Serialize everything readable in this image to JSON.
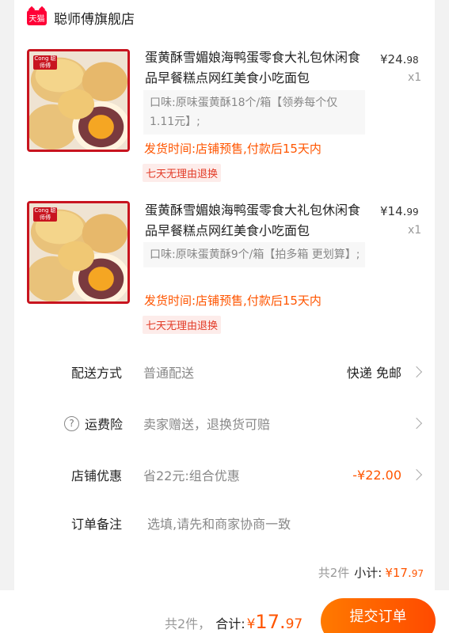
{
  "shop": {
    "badge": "天猫",
    "name": "聪师傅旗舰店"
  },
  "products": [
    {
      "brand": "Cong 聪师傅",
      "title": "蛋黄酥雪媚娘海鸭蛋零食大礼包休闲食品早餐糕点网红美食小吃面包",
      "price_int": "¥24.",
      "price_dec": "98",
      "qty": "x1",
      "spec": "口味:原味蛋黄酥18个/箱【领券每个仅1.11元】;",
      "ship_time": "发货时间:店铺预售,付款后15天内",
      "return_badge": "七天无理由退换"
    },
    {
      "brand": "Cong 聪师傅",
      "title": "蛋黄酥雪媚娘海鸭蛋零食大礼包休闲食品早餐糕点网红美食小吃面包",
      "price_int": "¥14.",
      "price_dec": "99",
      "qty": "x1",
      "spec": "口味:原味蛋黄酥9个/箱【拍多箱 更划算】;",
      "ship_time": "发货时间:店铺预售,付款后15天内",
      "return_badge": "七天无理由退换"
    }
  ],
  "delivery": {
    "label": "配送方式",
    "value": "普通配送",
    "right": "快递 免邮"
  },
  "shipping_insurance": {
    "icon": "?",
    "label": "运费险",
    "value": "卖家赠送，退换货可赔"
  },
  "shop_discount": {
    "label": "店铺优惠",
    "value": "省22元:组合优惠",
    "right": "-¥22.00"
  },
  "order_note": {
    "label": "订单备注",
    "placeholder": "选填,请先和商家协商一致"
  },
  "subtotal": {
    "count": "共2件",
    "label": "小计:",
    "amount_int": "¥17.",
    "amount_dec": "97"
  },
  "bottom": {
    "count": "共2件，",
    "total_label": "合计:",
    "currency": "¥",
    "amount_int": "17.",
    "amount_dec": "97",
    "submit": "提交订单"
  },
  "colors": {
    "accent": "#ff5500",
    "tmall_red": "#ff0036",
    "thumb_border": "#c8141f"
  }
}
